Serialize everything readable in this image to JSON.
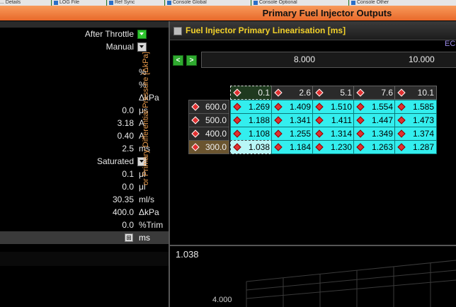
{
  "tabs": [
    "... Details",
    "LOG File",
    "Ref Sync",
    "Console Global",
    "Console Optional",
    "Console Other"
  ],
  "window_title": "Primary Fuel Injector Outputs",
  "left_panel": {
    "rows": [
      {
        "value": "After Throttle",
        "unit": "",
        "dropdown": "green"
      },
      {
        "value": "Manual",
        "unit": "",
        "dropdown": "grey"
      },
      {
        "value": "",
        "unit": ""
      },
      {
        "value": "",
        "unit": "%"
      },
      {
        "value": "",
        "unit": "%"
      },
      {
        "value": "",
        "unit": "ΔkPa"
      },
      {
        "value": "0.0",
        "unit": "μs"
      },
      {
        "value": "3.18",
        "unit": "A"
      },
      {
        "value": "0.40",
        "unit": "A"
      },
      {
        "value": "2.5",
        "unit": "ms"
      },
      {
        "value": "Saturated",
        "unit": "",
        "dropdown": "grey"
      },
      {
        "value": "0.1",
        "unit": "μl"
      },
      {
        "value": "0.0",
        "unit": "μl"
      },
      {
        "value": "30.35",
        "unit": "ml/s"
      },
      {
        "value": "400.0",
        "unit": "ΔkPa"
      },
      {
        "value": "0.0",
        "unit": "%Trim"
      },
      {
        "value": "",
        "unit": "ms",
        "selected": true
      }
    ]
  },
  "table_panel": {
    "title": "Fuel Injector Primary Linearisation [ms]",
    "ecu_label": "ECU",
    "x_axis_ticks": [
      "8.000",
      "10.000"
    ],
    "y_axis_label": "or Primary Differential Pressure [ΔkPa]",
    "col_headers": [
      "0.1",
      "2.6",
      "5.1",
      "7.6",
      "10.1"
    ],
    "row_headers": [
      "600.0",
      "500.0",
      "400.0",
      "300.0"
    ],
    "cells": [
      [
        "1.269",
        "1.409",
        "1.510",
        "1.554",
        "1.585"
      ],
      [
        "1.188",
        "1.341",
        "1.411",
        "1.447",
        "1.473"
      ],
      [
        "1.108",
        "1.255",
        "1.314",
        "1.349",
        "1.374"
      ],
      [
        "1.038",
        "1.184",
        "1.230",
        "1.263",
        "1.287"
      ]
    ],
    "selected": {
      "row": 3,
      "col": 0
    },
    "graph": {
      "current_value": "1.038",
      "y_tick": "4.000"
    }
  },
  "colors": {
    "cell_bg": "#33eeee",
    "title_fg": "#f2d12a",
    "accent_orange": "#e8692a"
  }
}
